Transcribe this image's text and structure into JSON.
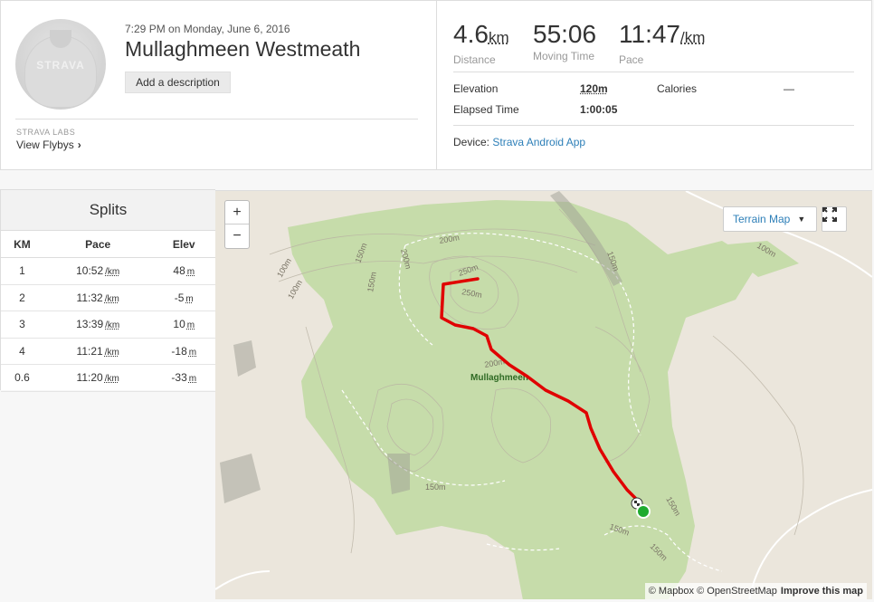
{
  "header": {
    "date": "7:29 PM on Monday, June 6, 2016",
    "title": "Mullaghmeen Westmeath",
    "add_description": "Add a description",
    "avatar_logo": "STRAVA",
    "labs_label": "STRAVA LABS",
    "flybys_label": "View Flybys",
    "chevron": "›"
  },
  "stats": {
    "distance": {
      "value": "4.6",
      "unit": "km",
      "label": "Distance"
    },
    "moving_time": {
      "value": "55:06",
      "label": "Moving Time"
    },
    "pace": {
      "value": "11:47",
      "unit": "/km",
      "label": "Pace"
    },
    "elevation_label": "Elevation",
    "elevation_value": "120m",
    "calories_label": "Calories",
    "calories_value": "—",
    "elapsed_label": "Elapsed Time",
    "elapsed_value": "1:00:05",
    "device_label": "Device:",
    "device_value": "Strava Android App"
  },
  "splits": {
    "title": "Splits",
    "columns": [
      "KM",
      "Pace",
      "Elev"
    ],
    "pace_unit": "/km",
    "elev_unit": "m",
    "rows": [
      {
        "km": "1",
        "pace": "10:52",
        "elev": "48"
      },
      {
        "km": "2",
        "pace": "11:32",
        "elev": "-5"
      },
      {
        "km": "3",
        "pace": "13:39",
        "elev": "10"
      },
      {
        "km": "4",
        "pace": "11:21",
        "elev": "-18"
      },
      {
        "km": "0.6",
        "pace": "11:20",
        "elev": "-33"
      }
    ]
  },
  "map": {
    "zoom_in": "+",
    "zoom_out": "−",
    "terrain_label": "Terrain Map",
    "caret": "▼",
    "place_label": "Mullaghmeen",
    "contour_labels": [
      "200m",
      "250m",
      "250m",
      "150m",
      "150m",
      "150m",
      "100m",
      "100m",
      "200m",
      "150m",
      "150m",
      "150m",
      "150m",
      "100m",
      "200m"
    ],
    "attribution": "© Mapbox © OpenStreetMap",
    "improve_label": "Improve this map",
    "colors": {
      "forest": "#c5dca9",
      "ground": "#ebe6dc",
      "route": "#e00000",
      "end_marker": "#1faa2f"
    }
  }
}
